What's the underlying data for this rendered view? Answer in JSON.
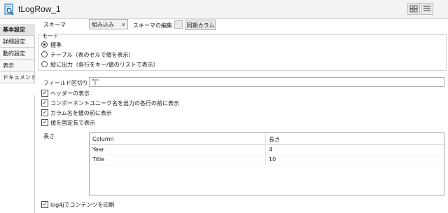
{
  "window": {
    "title": "tLogRow_1",
    "icon": "search-document-icon"
  },
  "tabs": [
    {
      "label": "基本設定",
      "active": true
    },
    {
      "label": "詳細設定",
      "active": false
    },
    {
      "label": "動的設定",
      "active": false
    },
    {
      "label": "表示",
      "active": false
    },
    {
      "label": "ドキュメント",
      "active": false
    }
  ],
  "schema": {
    "label": "スキーマ",
    "value": "組み込み",
    "edit_label": "スキーマの編集",
    "sync_button": "同期カラム"
  },
  "mode": {
    "title": "モード",
    "options": [
      {
        "label": "標準",
        "selected": true
      },
      {
        "label": "テーブル（表のセルで値を表示）",
        "selected": false
      },
      {
        "label": "縦に出力（各行をキー/値のリストで表示）",
        "selected": false
      }
    ]
  },
  "separator": {
    "label": "フィールド区切り",
    "value": "\"|\""
  },
  "checkboxes": [
    {
      "label": "ヘッダーの表示",
      "checked": true
    },
    {
      "label": "コンポーネントユニーク名を出力の各行の前に表示",
      "checked": true
    },
    {
      "label": "カラム名を値の前に表示",
      "checked": true
    },
    {
      "label": "値を固定長で表示",
      "checked": true
    }
  ],
  "length_table": {
    "label": "長さ",
    "columns": [
      "Column",
      "長さ"
    ],
    "rows": [
      [
        "Year",
        "4"
      ],
      [
        "Title",
        "10"
      ]
    ]
  },
  "log4j": {
    "label": "log4jでコンテンツを印刷",
    "checked": true
  }
}
